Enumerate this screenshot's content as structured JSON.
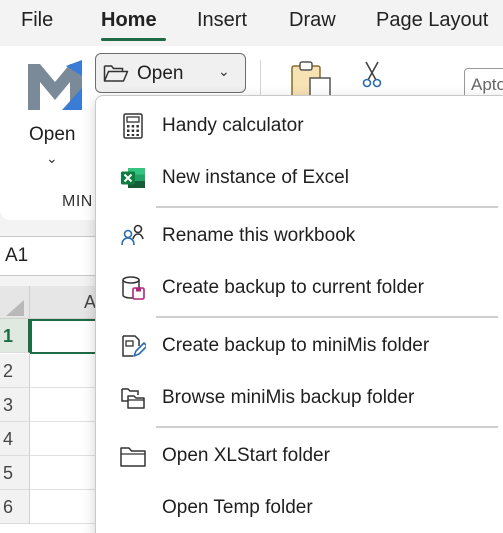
{
  "tabs": [
    {
      "label": "File"
    },
    {
      "label": "Home"
    },
    {
      "label": "Insert"
    },
    {
      "label": "Draw"
    },
    {
      "label": "Page Layout"
    }
  ],
  "active_tab": "Home",
  "ribbon": {
    "big_open_label": "Open",
    "group_label": "MIN",
    "split_open_label": "Open",
    "font_box_value": "Apto"
  },
  "name_box": {
    "value": "A1"
  },
  "grid": {
    "column_header": "A",
    "rows": [
      "1",
      "2",
      "3",
      "4",
      "5",
      "6"
    ],
    "selected_row": "1"
  },
  "menu": {
    "items": [
      {
        "label": "Handy calculator",
        "icon": "calculator-icon"
      },
      {
        "label": "New instance of Excel",
        "icon": "excel-icon"
      },
      {
        "label": "Rename this workbook",
        "icon": "rename-users-icon"
      },
      {
        "label": "Create backup to current folder",
        "icon": "backup-cylinder-icon"
      },
      {
        "label": "Create backup to miniMis folder",
        "icon": "backup-pen-icon"
      },
      {
        "label": "Browse miniMis backup folder",
        "icon": "browse-folders-icon"
      },
      {
        "label": "Open XLStart folder",
        "icon": "folder-icon"
      },
      {
        "label": "Open Temp folder",
        "icon": ""
      }
    ]
  },
  "colors": {
    "accent": "#1e6b45",
    "excel_green": "#107c41",
    "icon_blue": "#2b6cb0",
    "logo_blue": "#3a7bd5",
    "logo_gray": "#7a8a99"
  }
}
